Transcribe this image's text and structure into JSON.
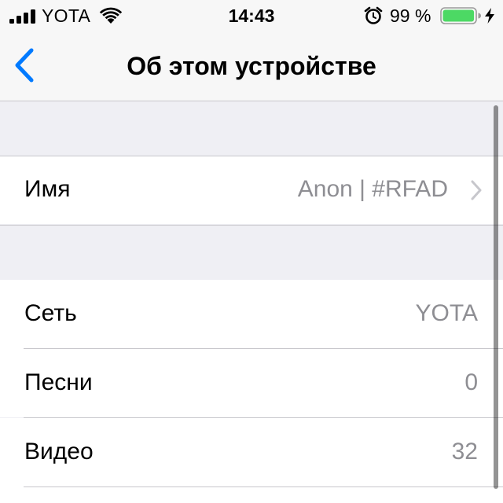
{
  "status_bar": {
    "carrier": "YOTA",
    "time": "14:43",
    "battery_percent": "99 %",
    "battery_level": 0.99,
    "battery_color": "#4cd964",
    "icons": [
      "signal-bars-icon",
      "wifi-icon",
      "alarm-icon",
      "battery-icon",
      "charging-bolt-icon"
    ]
  },
  "nav": {
    "back_icon": "chevron-left-icon",
    "title": "Об этом устройстве",
    "accent_color": "#007aff"
  },
  "name_section": {
    "label": "Имя",
    "value": "Anon | #RFAD",
    "chevron_icon": "chevron-right-icon"
  },
  "info_rows": [
    {
      "label": "Сеть",
      "value": "YOTA"
    },
    {
      "label": "Песни",
      "value": "0"
    },
    {
      "label": "Видео",
      "value": "32"
    }
  ]
}
